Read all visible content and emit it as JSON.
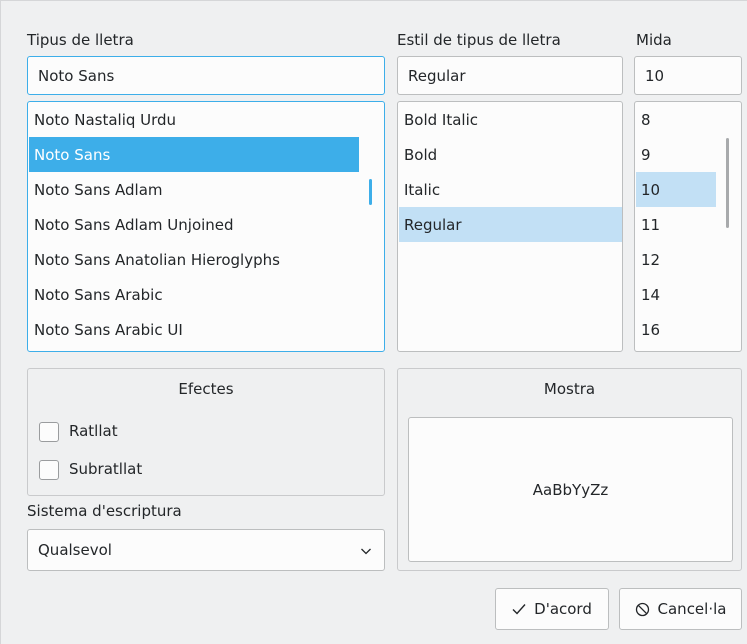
{
  "family": {
    "label": "Tipus de lletra",
    "value": "Noto Sans",
    "items": [
      "Noto Nastaliq Urdu",
      "Noto Sans",
      "Noto Sans Adlam",
      "Noto Sans Adlam Unjoined",
      "Noto Sans Anatolian Hieroglyphs",
      "Noto Sans Arabic",
      "Noto Sans Arabic UI"
    ],
    "selected": "Noto Sans"
  },
  "style": {
    "label": "Estil de tipus de lletra",
    "value": "Regular",
    "items": [
      "Bold Italic",
      "Bold",
      "Italic",
      "Regular"
    ],
    "selected": "Regular"
  },
  "size": {
    "label": "Mida",
    "value": "10",
    "items": [
      "8",
      "9",
      "10",
      "11",
      "12",
      "14",
      "16"
    ],
    "selected": "10"
  },
  "effects": {
    "title": "Efectes",
    "strikeout": {
      "label": "Ratllat",
      "checked": false
    },
    "underline": {
      "label": "Subratllat",
      "checked": false
    }
  },
  "writing_system": {
    "label": "Sistema d'escriptura",
    "value": "Qualsevol"
  },
  "sample": {
    "title": "Mostra",
    "text": "AaBbYyZz"
  },
  "buttons": {
    "ok": "D'acord",
    "cancel": "Cancel·la"
  },
  "icons": {
    "ok": "checkmark-icon",
    "cancel": "cancel-circle-icon",
    "combo": "chevron-down-icon"
  },
  "colors": {
    "accent": "#3daee9",
    "selection_soft": "#c2e0f5",
    "window_bg": "#eff0f1"
  }
}
